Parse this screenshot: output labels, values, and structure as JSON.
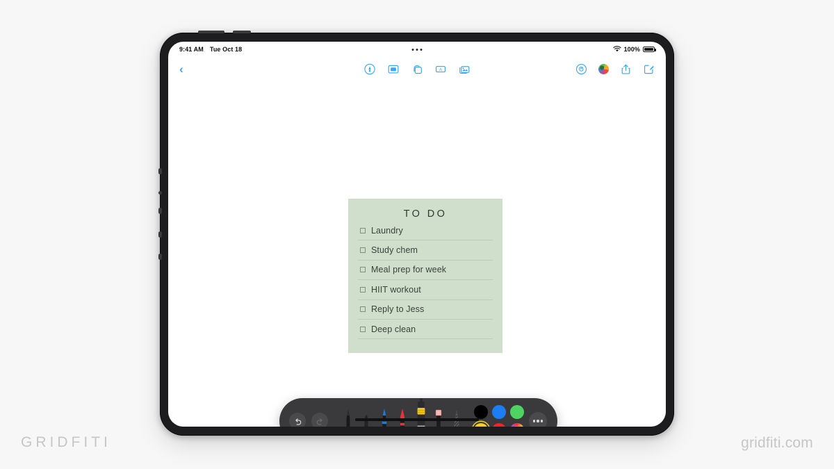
{
  "watermarks": {
    "left": "GRIDFITI",
    "right": "gridfiti.com"
  },
  "device": {
    "name": "iPad Pro",
    "orientation": "landscape"
  },
  "status_bar": {
    "time": "9:41 AM",
    "date": "Tue Oct 18",
    "battery_percent": "100%",
    "wifi_icon": "wifi-icon",
    "battery_icon": "battery-icon",
    "multitask_icon": "multitask-handle-icon"
  },
  "toolbar": {
    "back_label": "‹",
    "center_items": [
      {
        "name": "markup-pen-button",
        "icon": "pen-circle-icon"
      },
      {
        "name": "sticker-button",
        "icon": "sticker-window-icon"
      },
      {
        "name": "pages-button",
        "icon": "stacked-pages-icon"
      },
      {
        "name": "text-box-button",
        "icon": "text-box-icon"
      },
      {
        "name": "insert-media-button",
        "icon": "photo-stack-icon"
      }
    ],
    "right_items": [
      {
        "name": "lasso-button",
        "icon": "lasso-spiral-icon"
      },
      {
        "name": "color-palette-button",
        "icon": "color-palette-icon"
      },
      {
        "name": "share-button",
        "icon": "share-up-arrow-icon"
      },
      {
        "name": "compose-button",
        "icon": "compose-pencil-icon"
      }
    ]
  },
  "note": {
    "title": "TO DO",
    "background_color": "#cfdfcc",
    "rule_color": "#b9cdb5",
    "text_color": "#39423a",
    "items": [
      {
        "label": "Laundry",
        "checked": false
      },
      {
        "label": "Study chem",
        "checked": false
      },
      {
        "label": "Meal prep for week",
        "checked": false
      },
      {
        "label": "HIIT workout",
        "checked": false
      },
      {
        "label": "Reply to Jess",
        "checked": false
      },
      {
        "label": "Deep clean",
        "checked": false
      }
    ]
  },
  "pencil_palette": {
    "undo_label": "undo-icon",
    "redo_label": "redo-icon",
    "redo_disabled": true,
    "more_label": "more-options-icon",
    "tools": [
      {
        "name": "fountain-pen-tool",
        "color": "#1b1b1d",
        "selected": false
      },
      {
        "name": "pencil-tool",
        "color": "#2a2a2c",
        "selected": false
      },
      {
        "name": "blue-pen-tool",
        "color": "#1f7ae0",
        "selected": false
      },
      {
        "name": "red-marker-tool",
        "color": "#e8333c",
        "selected": false
      },
      {
        "name": "yellow-highlighter-tool",
        "color": "#f2c516",
        "selected": true
      },
      {
        "name": "eraser-tool",
        "color": "#f0a0a0",
        "selected": false
      },
      {
        "name": "ruler-tool",
        "color": "#3f3f41",
        "selected": false
      }
    ],
    "colors": [
      {
        "name": "swatch-black",
        "hex": "#000000",
        "selected": false
      },
      {
        "name": "swatch-blue",
        "hex": "#1d7df5",
        "selected": false
      },
      {
        "name": "swatch-green",
        "hex": "#4fd463",
        "selected": false
      },
      {
        "name": "swatch-yellow",
        "hex": "#f2d023",
        "selected": true
      },
      {
        "name": "swatch-red",
        "hex": "#f0242c",
        "selected": false
      },
      {
        "name": "swatch-rainbow",
        "hex": "rainbow",
        "selected": false
      }
    ]
  }
}
